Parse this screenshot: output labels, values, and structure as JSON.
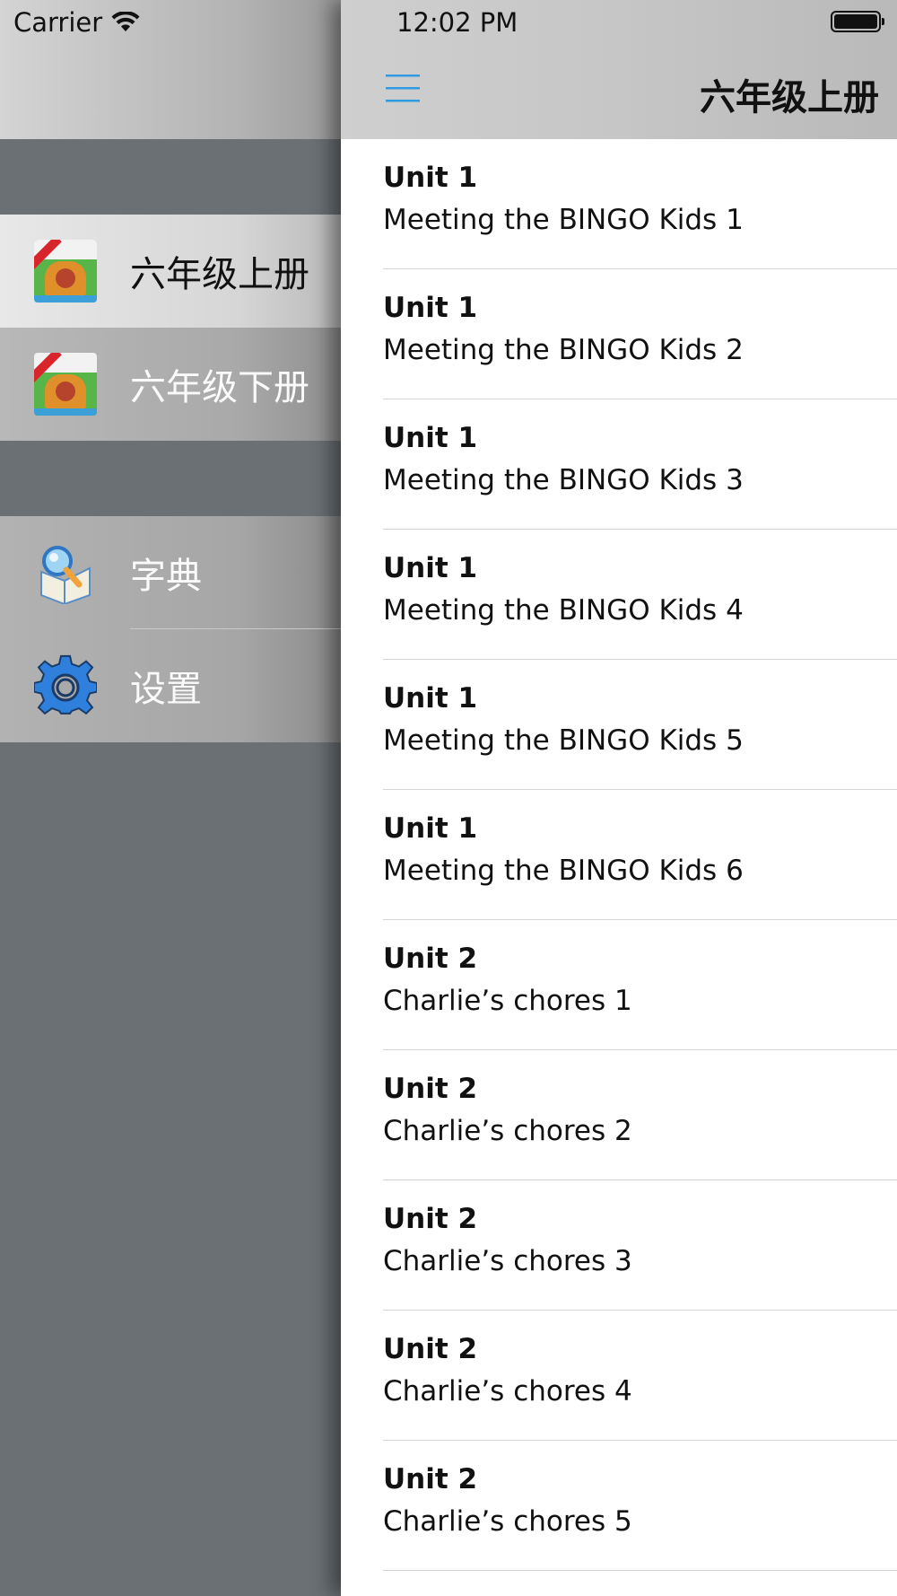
{
  "status_bar": {
    "carrier": "Carrier",
    "time": "12:02 PM"
  },
  "drawer": {
    "books": [
      {
        "label": "六年级上册",
        "icon": "book-cover-icon",
        "selected": true
      },
      {
        "label": "六年级下册",
        "icon": "book-cover-icon",
        "selected": false
      }
    ],
    "tools": [
      {
        "label": "字典",
        "icon": "dictionary-icon"
      },
      {
        "label": "设置",
        "icon": "gear-icon"
      }
    ]
  },
  "nav": {
    "title": "六年级上册",
    "menu_icon": "hamburger-menu-icon",
    "accent_color": "#2f9be0"
  },
  "lessons": [
    {
      "unit": "Unit 1",
      "title": "Meeting the BINGO Kids 1"
    },
    {
      "unit": "Unit 1",
      "title": "Meeting the BINGO Kids 2"
    },
    {
      "unit": "Unit 1",
      "title": "Meeting the BINGO Kids 3"
    },
    {
      "unit": "Unit 1",
      "title": "Meeting the BINGO Kids 4"
    },
    {
      "unit": "Unit 1",
      "title": "Meeting the BINGO Kids 5"
    },
    {
      "unit": "Unit 1",
      "title": "Meeting the BINGO Kids 6"
    },
    {
      "unit": "Unit 2",
      "title": "Charlie’s chores 1"
    },
    {
      "unit": "Unit 2",
      "title": "Charlie’s chores 2"
    },
    {
      "unit": "Unit 2",
      "title": "Charlie’s chores 3"
    },
    {
      "unit": "Unit 2",
      "title": "Charlie’s chores 4"
    },
    {
      "unit": "Unit 2",
      "title": "Charlie’s chores 5"
    }
  ]
}
